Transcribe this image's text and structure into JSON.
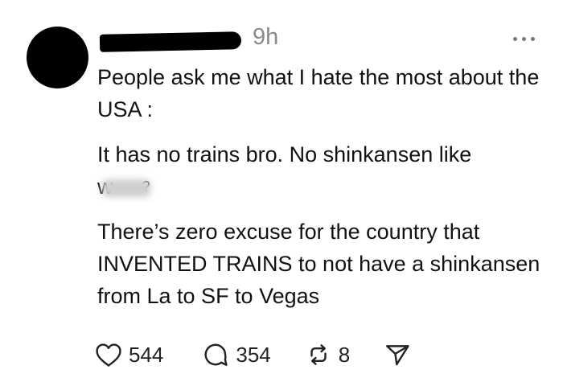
{
  "post": {
    "timestamp": "9h",
    "paragraphs": [
      "People ask me what I hate the most about the USA :",
      "It has no trains bro. No shinkansen like",
      "There’s zero excuse for the country that INVENTED TRAINS to not have a shinkansen from La to SF to Vegas"
    ],
    "partial_redacted_text": "w",
    "partial_trailing_text": "?"
  },
  "actions": {
    "likes": "544",
    "replies": "354",
    "reposts": "8"
  },
  "icons": [
    "avatar",
    "more-icon",
    "heart-icon",
    "comment-icon",
    "repost-icon",
    "send-icon"
  ]
}
